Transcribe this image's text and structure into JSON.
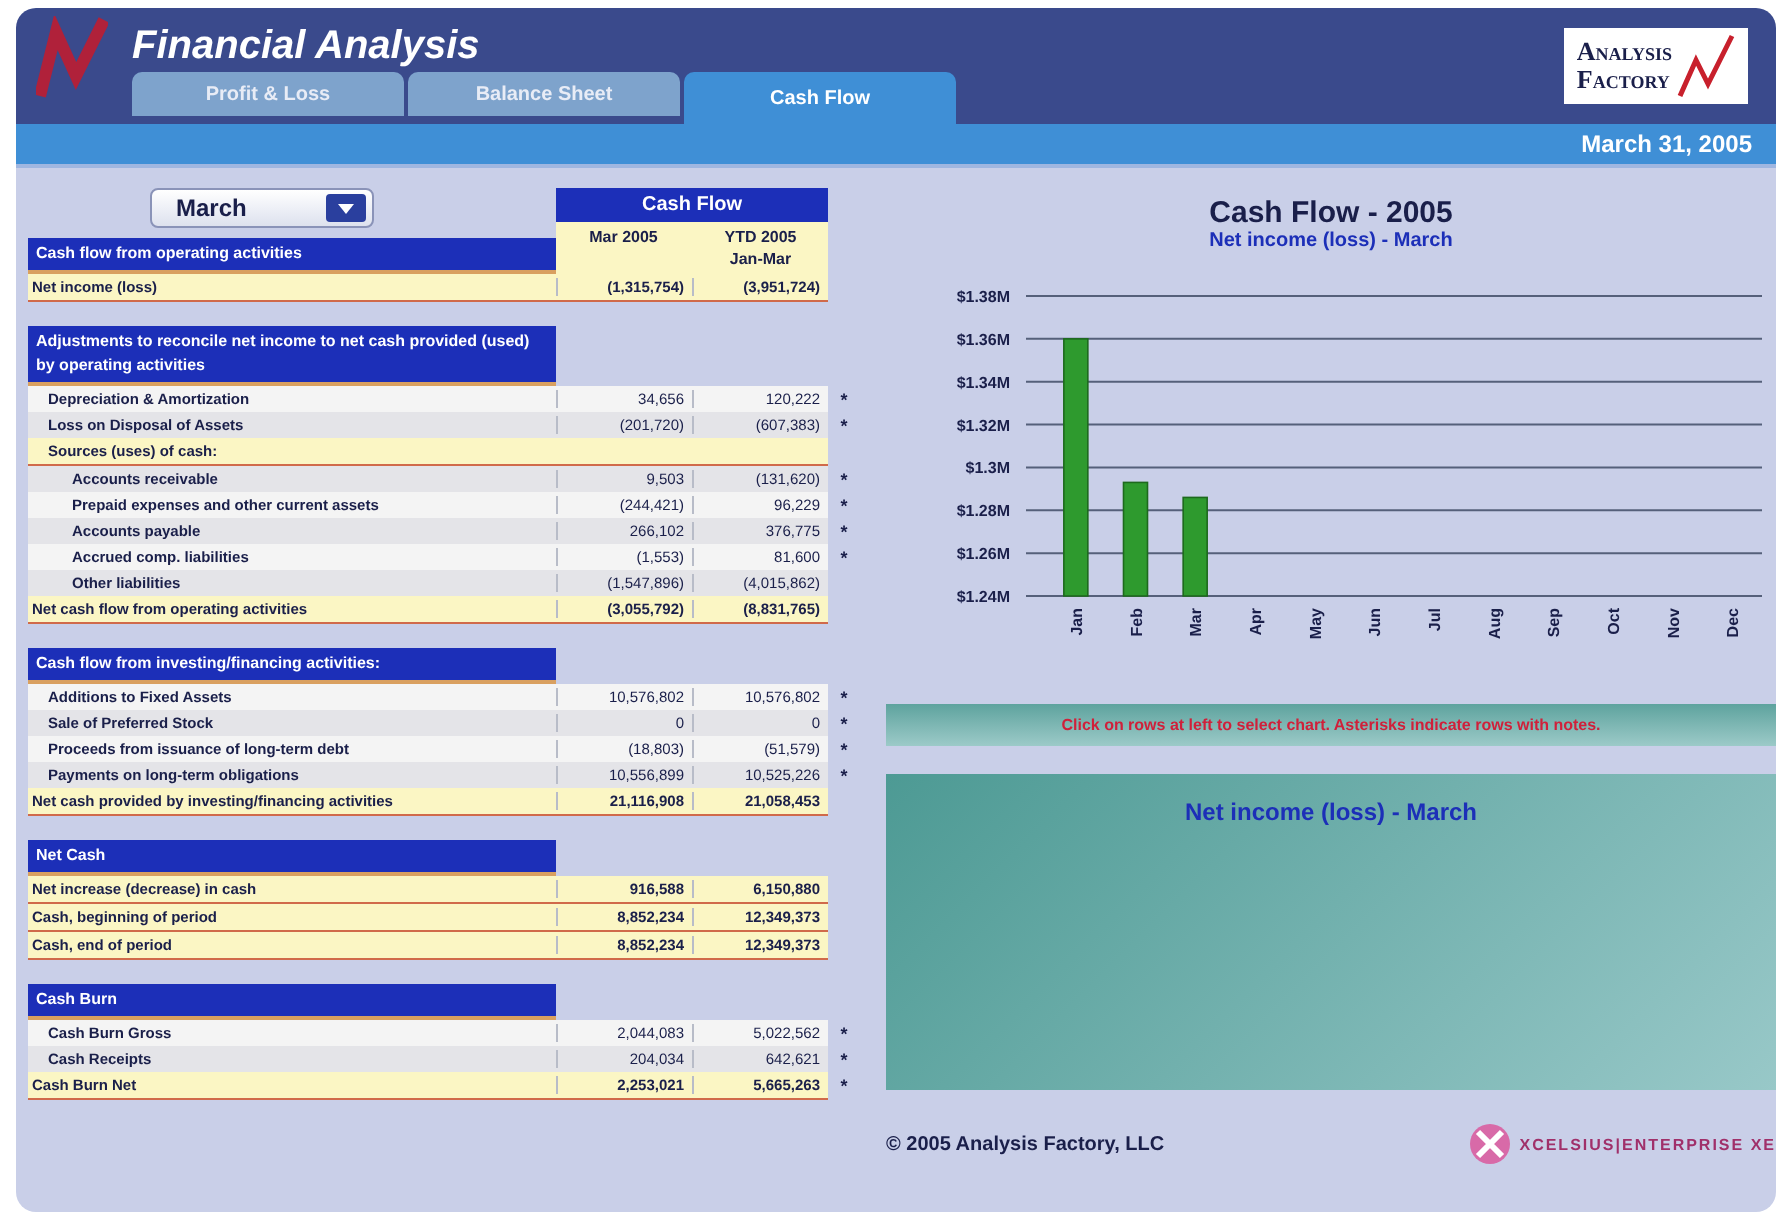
{
  "header": {
    "title": "Financial Analysis",
    "logo_line_1": "Analysis",
    "logo_line_2": "Factory"
  },
  "tabs": [
    {
      "label": "Profit & Loss",
      "selected": false
    },
    {
      "label": "Balance Sheet",
      "selected": false
    },
    {
      "label": "Cash Flow",
      "selected": true
    }
  ],
  "date": "March 31, 2005",
  "month_select": {
    "value": "March"
  },
  "table": {
    "title": "Cash Flow",
    "columns": [
      {
        "line_1": "Mar 2005"
      },
      {
        "line_1": "YTD 2005",
        "line_2": "Jan-Mar"
      }
    ],
    "sections": [
      {
        "title": "Cash flow from operating activities",
        "rows": [
          {
            "kind": "total",
            "label": "Net income (loss)",
            "values": [
              "(1,315,754)",
              "(3,951,724)"
            ]
          }
        ]
      },
      {
        "title": "Adjustments to reconcile net income to net cash provided (used) by operating activities",
        "rows": [
          {
            "kind": "item",
            "label": "Depreciation & Amortization",
            "values": [
              "34,656",
              "120,222"
            ],
            "note": "*"
          },
          {
            "kind": "item",
            "label": "Loss on Disposal of Assets",
            "values": [
              "(201,720)",
              "(607,383)"
            ],
            "note": "*"
          },
          {
            "kind": "subhead",
            "label": "Sources (uses) of cash:"
          },
          {
            "kind": "subitem",
            "label": "Accounts receivable",
            "values": [
              "9,503",
              "(131,620)"
            ],
            "note": "*"
          },
          {
            "kind": "subitem",
            "label": "Prepaid expenses and other current assets",
            "values": [
              "(244,421)",
              "96,229"
            ],
            "note": "*"
          },
          {
            "kind": "subitem",
            "label": "Accounts payable",
            "values": [
              "266,102",
              "376,775"
            ],
            "note": "*"
          },
          {
            "kind": "subitem",
            "label": "Accrued comp. liabilities",
            "values": [
              "(1,553)",
              "81,600"
            ],
            "note": "*"
          },
          {
            "kind": "subitem",
            "label": "Other liabilities",
            "values": [
              "(1,547,896)",
              "(4,015,862)"
            ]
          },
          {
            "kind": "total",
            "label": "Net cash flow from operating activities",
            "values": [
              "(3,055,792)",
              "(8,831,765)"
            ]
          }
        ]
      },
      {
        "title": "Cash flow from investing/financing activities:",
        "rows": [
          {
            "kind": "item",
            "label": "Additions to Fixed Assets",
            "values": [
              "10,576,802",
              "10,576,802"
            ],
            "note": "*"
          },
          {
            "kind": "item",
            "label": "Sale of Preferred Stock",
            "values": [
              "0",
              "0"
            ],
            "note": "*"
          },
          {
            "kind": "item",
            "label": "Proceeds from issuance of long-term debt",
            "values": [
              "(18,803)",
              "(51,579)"
            ],
            "note": "*"
          },
          {
            "kind": "item",
            "label": "Payments on long-term obligations",
            "values": [
              "10,556,899",
              "10,525,226"
            ],
            "note": "*"
          },
          {
            "kind": "total",
            "label": "Net cash provided by investing/financing activities",
            "values": [
              "21,116,908",
              "21,058,453"
            ]
          }
        ]
      },
      {
        "title": "Net Cash",
        "rows": [
          {
            "kind": "total",
            "label": "Net increase (decrease) in cash",
            "values": [
              "916,588",
              "6,150,880"
            ]
          },
          {
            "kind": "total",
            "label": "Cash, beginning of period",
            "values": [
              "8,852,234",
              "12,349,373"
            ]
          },
          {
            "kind": "total",
            "label": "Cash, end of period",
            "values": [
              "8,852,234",
              "12,349,373"
            ]
          }
        ]
      },
      {
        "title": "Cash Burn",
        "rows": [
          {
            "kind": "item",
            "label": "Cash Burn Gross",
            "values": [
              "2,044,083",
              "5,022,562"
            ],
            "note": "*"
          },
          {
            "kind": "item",
            "label": "Cash Receipts",
            "values": [
              "204,034",
              "642,621"
            ],
            "note": "*"
          },
          {
            "kind": "total",
            "label": "Cash Burn Net",
            "values": [
              "2,253,021",
              "5,665,263"
            ],
            "note": "*"
          }
        ]
      }
    ]
  },
  "chart": {
    "title": "Cash Flow - 2005",
    "subtitle": "Net income (loss) - March",
    "chart_data": {
      "type": "bar",
      "categories": [
        "Jan",
        "Feb",
        "Mar",
        "Apr",
        "May",
        "Jun",
        "Jul",
        "Aug",
        "Sep",
        "Oct",
        "Nov",
        "Dec"
      ],
      "grid": true,
      "series": [
        {
          "color": "#2e9a2e",
          "values": [
            1.36,
            1.293,
            1.286,
            null,
            null,
            null,
            null,
            null,
            null,
            null,
            null,
            null
          ]
        }
      ],
      "ylim": [
        1.24,
        1.38
      ],
      "yticks": [
        {
          "value": 1.24,
          "label": "$1.24M"
        },
        {
          "value": 1.26,
          "label": "$1.26M"
        },
        {
          "value": 1.28,
          "label": "$1.28M"
        },
        {
          "value": 1.3,
          "label": "$1.3M"
        },
        {
          "value": 1.32,
          "label": "$1.32M"
        },
        {
          "value": 1.34,
          "label": "$1.34M"
        },
        {
          "value": 1.36,
          "label": "$1.36M"
        },
        {
          "value": 1.38,
          "label": "$1.38M"
        }
      ]
    }
  },
  "hint": "Click on rows at left to select chart.  Asterisks indicate rows with notes.",
  "notes_panel": {
    "title": "Net income (loss) - March"
  },
  "footer": {
    "copyright": "© 2005 Analysis Factory, LLC",
    "brand": "XCELSIUS|ENTERPRISE XE"
  }
}
